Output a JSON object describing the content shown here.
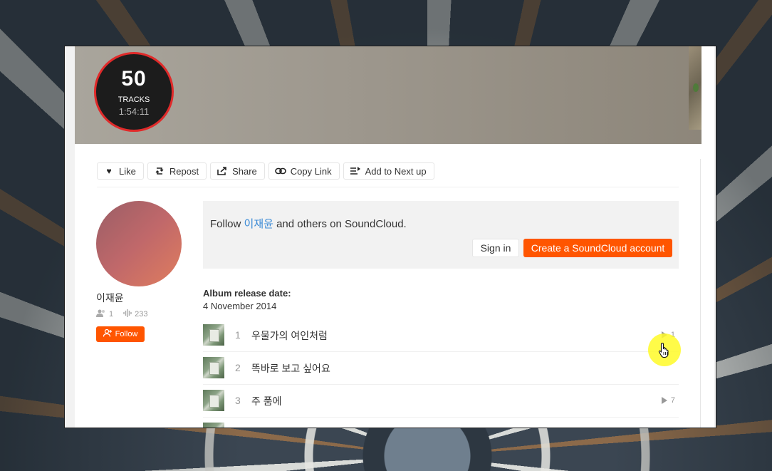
{
  "playlist": {
    "track_count": "50",
    "track_label": "TRACKS",
    "duration": "1:54:11"
  },
  "actions": [
    {
      "label": "Like",
      "icon": "heart-icon"
    },
    {
      "label": "Repost",
      "icon": "repost-icon"
    },
    {
      "label": "Share",
      "icon": "share-icon"
    },
    {
      "label": "Copy Link",
      "icon": "link-icon"
    },
    {
      "label": "Add to Next up",
      "icon": "queue-icon"
    }
  ],
  "user": {
    "name": "이재윤",
    "followers": "1",
    "tracks": "233",
    "follow_label": "Follow"
  },
  "promo": {
    "prefix": "Follow ",
    "name": "이재윤",
    "suffix": " and others on SoundCloud.",
    "signin_label": "Sign in",
    "create_label": "Create a SoundCloud account"
  },
  "release": {
    "label": "Album release date:",
    "date": "4 November 2014"
  },
  "tracks": [
    {
      "num": "1",
      "title": "우물가의 여인처럼",
      "plays": "1"
    },
    {
      "num": "2",
      "title": "똑바로 보고 싶어요",
      "plays": ""
    },
    {
      "num": "3",
      "title": "주 품에",
      "plays": "7"
    },
    {
      "num": "",
      "title": "",
      "plays": ""
    }
  ],
  "colors": {
    "accent": "#ff5500",
    "link": "#3a8ad6",
    "badge_ring": "#e02a2a"
  }
}
